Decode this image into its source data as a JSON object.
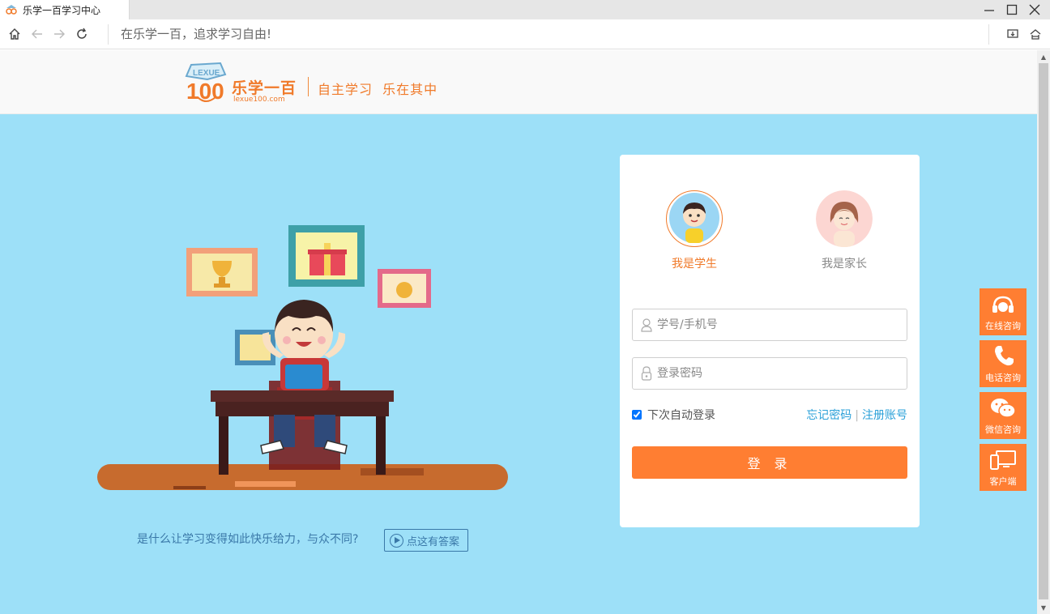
{
  "browser": {
    "tab_title": "乐学一百学习中心",
    "address_text": "在乐学一百，追求学习自由!"
  },
  "header": {
    "logo_badge": "LEXUE",
    "logo_number": "100",
    "brand_name": "乐学一百",
    "brand_url": "lexue100.com",
    "slogan": "自主学习  乐在其中"
  },
  "intro": {
    "question": "是什么让学习变得如此快乐给力，与众不同?",
    "answer_button": "点这有答案"
  },
  "login": {
    "roles": [
      {
        "label": "我是学生",
        "selected": true
      },
      {
        "label": "我是家长",
        "selected": false
      }
    ],
    "username_placeholder": "学号/手机号",
    "password_placeholder": "登录密码",
    "remember_label": "下次自动登录",
    "remember_checked": true,
    "forgot_link": "忘记密码",
    "link_separator": "|",
    "register_link": "注册账号",
    "submit_label": "登 录"
  },
  "side_tools": [
    {
      "label": "在线咨询",
      "icon": "headset-icon"
    },
    {
      "label": "电话咨询",
      "icon": "phone-icon"
    },
    {
      "label": "微信咨询",
      "icon": "wechat-icon"
    },
    {
      "label": "客户端",
      "icon": "devices-icon"
    }
  ],
  "colors": {
    "accent": "#ff7e32",
    "page_background": "#9de0f8",
    "link": "#2aa0d8"
  }
}
